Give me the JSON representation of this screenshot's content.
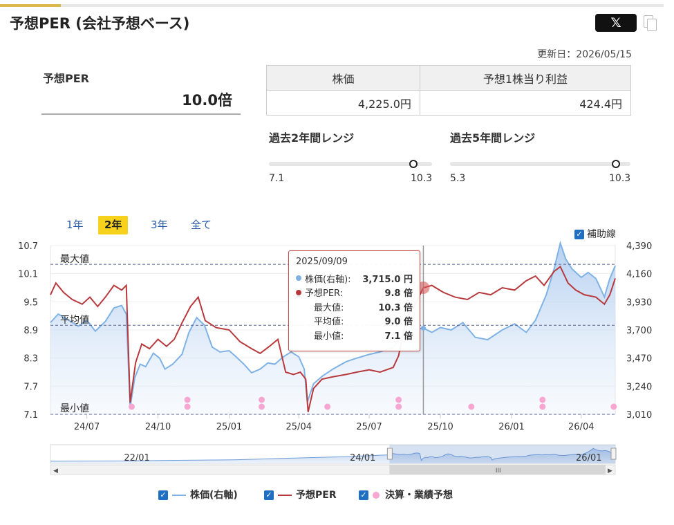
{
  "header": {
    "title": "予想PER (会社予想ベース)",
    "x_label": "𝕏",
    "updated": "更新日：2026/05/15"
  },
  "per": {
    "label": "予想PER",
    "value": "10.0倍"
  },
  "info_table": {
    "headers": [
      "株価",
      "予想1株当り利益"
    ],
    "values": [
      "4,225.0円",
      "424.4円"
    ]
  },
  "ranges": [
    {
      "label": "過去2年間レンジ",
      "min": "7.1",
      "max": "10.3",
      "current": 10.0,
      "min_val": 7.1,
      "max_val": 10.3
    },
    {
      "label": "過去5年間レンジ",
      "min": "5.3",
      "max": "10.3",
      "current": 10.0,
      "min_val": 5.3,
      "max_val": 10.3
    }
  ],
  "period_tabs": [
    {
      "label": "1年",
      "active": false
    },
    {
      "label": "2年",
      "active": true
    },
    {
      "label": "3年",
      "active": false
    },
    {
      "label": "全て",
      "active": false
    }
  ],
  "aux_toggle": {
    "label": "補助線",
    "check": "✓"
  },
  "tooltip": {
    "date": "2025/09/09",
    "rows": [
      {
        "key": "株価(右軸):",
        "value": "3,715.0 円"
      },
      {
        "key": "予想PER:",
        "value": "9.8 倍"
      },
      {
        "key": "最大値:",
        "value": "10.3 倍"
      },
      {
        "key": "平均値:",
        "value": "9.0 倍"
      },
      {
        "key": "最小値:",
        "value": "7.1 倍"
      }
    ]
  },
  "legend": [
    {
      "label": "株価(右軸)",
      "color": "#7fb2e5",
      "kind": "line"
    },
    {
      "label": "予想PER",
      "color": "#b8393d",
      "kind": "line"
    },
    {
      "label": "決算・業績予想",
      "color": "#f6a6d1",
      "kind": "dot"
    }
  ],
  "navigator": {
    "labels": [
      "22/01",
      "24/01",
      "26/01"
    ],
    "handle": "III"
  },
  "chart_data": {
    "type": "line",
    "y_left": {
      "ticks": [
        "10.7",
        "10.1",
        "9.5",
        "8.9",
        "8.3",
        "7.7",
        "7.1"
      ],
      "min": 7.1,
      "max": 10.7
    },
    "y_right": {
      "ticks": [
        "4,390",
        "4,160",
        "3,930",
        "3,700",
        "3,470",
        "3,240",
        "3,010"
      ],
      "min": 3010,
      "max": 4390
    },
    "x_ticks": [
      "24/07",
      "24/10",
      "25/01",
      "25/04",
      "25/07",
      "25/10",
      "26/01",
      "26/04"
    ],
    "reference_lines": [
      {
        "label": "最大値",
        "value": 10.3
      },
      {
        "label": "平均値",
        "value": 9.0
      },
      {
        "label": "最小値",
        "value": 7.1
      }
    ],
    "x_start": "2024-05-15",
    "x_end": "2026-05-15",
    "series": [
      {
        "name": "株価(右軸)",
        "axis": "right",
        "color": "#7fb2e5",
        "points": [
          [
            "2024-05-15",
            3760
          ],
          [
            "2024-05-25",
            3830
          ],
          [
            "2024-06-05",
            3790
          ],
          [
            "2024-06-20",
            3730
          ],
          [
            "2024-07-01",
            3780
          ],
          [
            "2024-07-12",
            3690
          ],
          [
            "2024-07-25",
            3770
          ],
          [
            "2024-08-05",
            3880
          ],
          [
            "2024-08-15",
            3900
          ],
          [
            "2024-08-21",
            3830
          ],
          [
            "2024-08-26",
            3070
          ],
          [
            "2024-09-01",
            3310
          ],
          [
            "2024-09-08",
            3420
          ],
          [
            "2024-09-15",
            3400
          ],
          [
            "2024-09-25",
            3510
          ],
          [
            "2024-10-03",
            3470
          ],
          [
            "2024-10-10",
            3380
          ],
          [
            "2024-10-20",
            3420
          ],
          [
            "2024-11-01",
            3500
          ],
          [
            "2024-11-10",
            3680
          ],
          [
            "2024-11-20",
            3800
          ],
          [
            "2024-11-30",
            3740
          ],
          [
            "2024-12-10",
            3560
          ],
          [
            "2024-12-20",
            3520
          ],
          [
            "2025-01-01",
            3530
          ],
          [
            "2025-01-10",
            3480
          ],
          [
            "2025-01-20",
            3420
          ],
          [
            "2025-01-30",
            3350
          ],
          [
            "2025-02-10",
            3380
          ],
          [
            "2025-02-20",
            3430
          ],
          [
            "2025-03-01",
            3420
          ],
          [
            "2025-03-12",
            3480
          ],
          [
            "2025-03-22",
            3520
          ],
          [
            "2025-04-01",
            3480
          ],
          [
            "2025-04-08",
            3380
          ],
          [
            "2025-04-12",
            3110
          ],
          [
            "2025-04-20",
            3260
          ],
          [
            "2025-05-01",
            3320
          ],
          [
            "2025-05-15",
            3380
          ],
          [
            "2025-06-01",
            3440
          ],
          [
            "2025-06-15",
            3470
          ],
          [
            "2025-07-01",
            3500
          ],
          [
            "2025-07-15",
            3520
          ],
          [
            "2025-08-01",
            3560
          ],
          [
            "2025-08-12",
            3650
          ],
          [
            "2025-08-25",
            3700
          ],
          [
            "2025-09-09",
            3715
          ],
          [
            "2025-09-20",
            3680
          ],
          [
            "2025-10-01",
            3720
          ],
          [
            "2025-10-15",
            3700
          ],
          [
            "2025-10-30",
            3760
          ],
          [
            "2025-11-15",
            3640
          ],
          [
            "2025-12-01",
            3620
          ],
          [
            "2025-12-20",
            3700
          ],
          [
            "2026-01-05",
            3750
          ],
          [
            "2026-01-20",
            3680
          ],
          [
            "2026-02-01",
            3780
          ],
          [
            "2026-02-15",
            3990
          ],
          [
            "2026-02-25",
            4200
          ],
          [
            "2026-03-05",
            4410
          ],
          [
            "2026-03-12",
            4280
          ],
          [
            "2026-03-20",
            4200
          ],
          [
            "2026-04-01",
            4130
          ],
          [
            "2026-04-10",
            4170
          ],
          [
            "2026-04-20",
            4120
          ],
          [
            "2026-05-01",
            3970
          ],
          [
            "2026-05-08",
            4120
          ],
          [
            "2026-05-15",
            4225
          ]
        ]
      },
      {
        "name": "予想PER",
        "axis": "left",
        "color": "#b8393d",
        "points": [
          [
            "2024-05-15",
            9.65
          ],
          [
            "2024-05-22",
            9.9
          ],
          [
            "2024-06-01",
            9.7
          ],
          [
            "2024-06-12",
            9.55
          ],
          [
            "2024-06-25",
            9.45
          ],
          [
            "2024-07-05",
            9.6
          ],
          [
            "2024-07-15",
            9.4
          ],
          [
            "2024-07-25",
            9.6
          ],
          [
            "2024-08-05",
            9.85
          ],
          [
            "2024-08-15",
            9.75
          ],
          [
            "2024-08-21",
            9.85
          ],
          [
            "2024-08-26",
            7.35
          ],
          [
            "2024-09-02",
            8.2
          ],
          [
            "2024-09-10",
            8.6
          ],
          [
            "2024-09-20",
            8.5
          ],
          [
            "2024-10-01",
            8.7
          ],
          [
            "2024-10-12",
            8.55
          ],
          [
            "2024-10-22",
            8.7
          ],
          [
            "2024-11-01",
            9.05
          ],
          [
            "2024-11-12",
            9.4
          ],
          [
            "2024-11-22",
            9.6
          ],
          [
            "2024-12-01",
            9.1
          ],
          [
            "2024-12-15",
            8.95
          ],
          [
            "2025-01-01",
            8.9
          ],
          [
            "2025-01-15",
            8.65
          ],
          [
            "2025-01-30",
            8.5
          ],
          [
            "2025-02-10",
            8.4
          ],
          [
            "2025-02-22",
            8.55
          ],
          [
            "2025-03-05",
            8.7
          ],
          [
            "2025-03-15",
            8.0
          ],
          [
            "2025-03-25",
            7.95
          ],
          [
            "2025-04-03",
            8.0
          ],
          [
            "2025-04-10",
            7.85
          ],
          [
            "2025-04-13",
            7.15
          ],
          [
            "2025-04-20",
            7.65
          ],
          [
            "2025-05-01",
            7.85
          ],
          [
            "2025-05-15",
            7.9
          ],
          [
            "2025-06-01",
            7.95
          ],
          [
            "2025-06-15",
            8.0
          ],
          [
            "2025-07-01",
            8.05
          ],
          [
            "2025-07-15",
            8.0
          ],
          [
            "2025-08-01",
            8.1
          ],
          [
            "2025-08-08",
            8.35
          ],
          [
            "2025-08-18",
            9.15
          ],
          [
            "2025-08-28",
            9.4
          ],
          [
            "2025-09-09",
            9.8
          ],
          [
            "2025-09-20",
            9.85
          ],
          [
            "2025-10-05",
            9.7
          ],
          [
            "2025-10-20",
            9.6
          ],
          [
            "2025-11-05",
            9.55
          ],
          [
            "2025-11-20",
            9.7
          ],
          [
            "2025-12-05",
            9.65
          ],
          [
            "2025-12-20",
            9.8
          ],
          [
            "2026-01-05",
            9.75
          ],
          [
            "2026-01-20",
            9.95
          ],
          [
            "2026-02-01",
            10.05
          ],
          [
            "2026-02-12",
            9.85
          ],
          [
            "2026-02-25",
            10.15
          ],
          [
            "2026-03-05",
            10.25
          ],
          [
            "2026-03-15",
            9.9
          ],
          [
            "2026-03-25",
            9.75
          ],
          [
            "2026-04-05",
            9.65
          ],
          [
            "2026-04-20",
            9.6
          ],
          [
            "2026-05-01",
            9.45
          ],
          [
            "2026-05-08",
            9.65
          ],
          [
            "2026-05-15",
            10.0
          ]
        ]
      }
    ],
    "event_markers": [
      [
        "2024-08-28",
        1
      ],
      [
        "2024-11-08",
        2
      ],
      [
        "2025-02-12",
        2
      ],
      [
        "2025-05-08",
        1
      ],
      [
        "2025-08-08",
        2
      ],
      [
        "2025-11-10",
        1
      ],
      [
        "2026-02-10",
        2
      ],
      [
        "2026-05-13",
        1
      ]
    ]
  }
}
